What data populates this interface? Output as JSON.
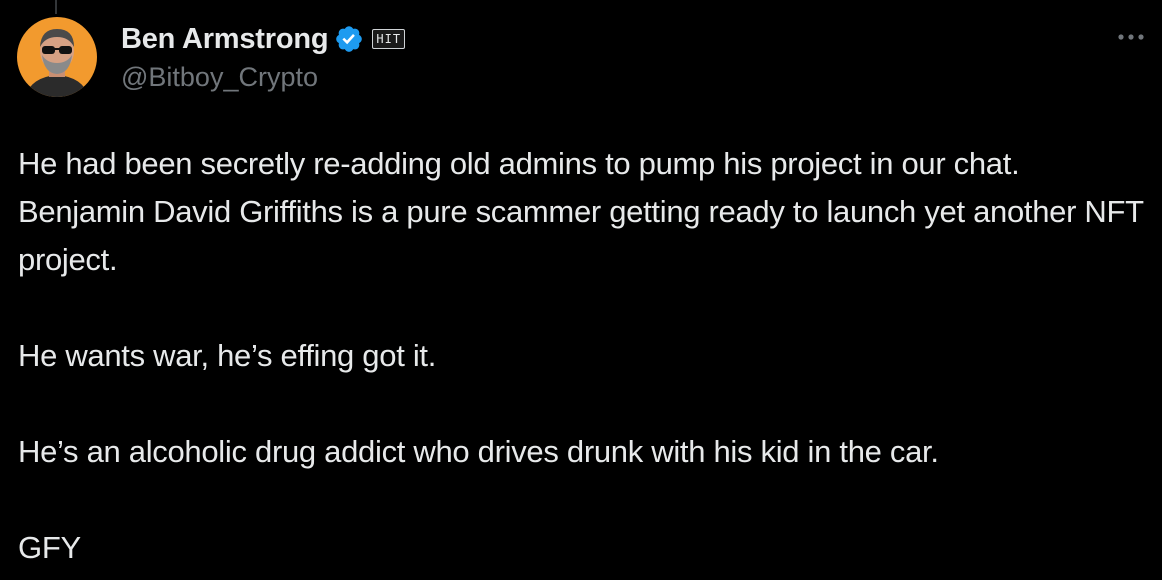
{
  "author": {
    "display_name": "Ben Armstrong",
    "handle": "@Bitboy_Crypto",
    "affiliate_badge": "HIT",
    "verified_icon": "verified-check-icon",
    "verified_color": "#1d9bf0"
  },
  "tweet": {
    "paragraphs": [
      "He had been secretly re-adding old admins to pump his project in our chat. Benjamin David Griffiths is a pure scammer getting ready to launch yet another NFT project.",
      "He wants war, he’s effing got it.",
      "He’s an alcoholic drug addict who drives drunk with his kid in the car.",
      "GFY"
    ]
  },
  "menu": {
    "icon": "more-options-icon"
  },
  "colors": {
    "background": "#000000",
    "text_primary": "#e7e9ea",
    "text_secondary": "#71767b",
    "avatar_bg": "#f29a2e"
  }
}
